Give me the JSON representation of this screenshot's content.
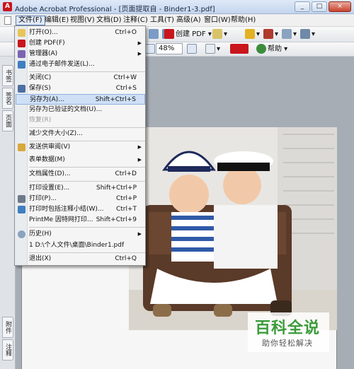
{
  "window": {
    "title": "Adobe Acrobat Professional - [页面提取自 - Binder1-3.pdf]",
    "min": "_",
    "restore": "□",
    "close": "×"
  },
  "menubar": [
    "文件(F)",
    "编辑(E)",
    "视图(V)",
    "文档(D)",
    "注释(C)",
    "工具(T)",
    "高级(A)",
    "窗口(W)",
    "帮助(H)"
  ],
  "toolbar": {
    "create_pdf": "创建 PDF",
    "zoom": "48%",
    "help": "帮助"
  },
  "left_tabs": [
    "书签",
    "签名",
    "页面",
    "附件",
    "注释"
  ],
  "file_menu": {
    "items": [
      {
        "label": "打开(O)...",
        "shortcut": "Ctrl+O"
      },
      {
        "label": "创建 PDF(F)",
        "shortcut": ""
      },
      {
        "label": "管理器(A)",
        "shortcut": ""
      },
      {
        "label": "通过电子邮件发送(L)...",
        "shortcut": ""
      },
      {
        "label": "关闭(C)",
        "shortcut": "Ctrl+W"
      },
      {
        "label": "保存(S)",
        "shortcut": "Ctrl+S"
      },
      {
        "label": "另存为(A)...",
        "shortcut": "Shift+Ctrl+S"
      },
      {
        "label": "另存为已验证的文档(U)...",
        "shortcut": ""
      },
      {
        "label": "恢复(R)",
        "shortcut": ""
      },
      {
        "label": "减少文件大小(Z)...",
        "shortcut": ""
      },
      {
        "label": "发送供审阅(V)",
        "shortcut": ""
      },
      {
        "label": "表单数据(M)",
        "shortcut": ""
      },
      {
        "label": "文档属性(D)...",
        "shortcut": "Ctrl+D"
      },
      {
        "label": "打印设置(E)...",
        "shortcut": "Shift+Ctrl+P"
      },
      {
        "label": "打印(P)...",
        "shortcut": "Ctrl+P"
      },
      {
        "label": "打印时包括注释小结(W)...",
        "shortcut": "Ctrl+T"
      },
      {
        "label": "PrintMe 因特网打印...",
        "shortcut": "Shift+Ctrl+9"
      },
      {
        "label": "历史(H)",
        "shortcut": ""
      },
      {
        "label": "1 D:\\个人文件\\桌面\\Binder1.pdf",
        "shortcut": ""
      },
      {
        "label": "退出(X)",
        "shortcut": "Ctrl+Q"
      }
    ]
  },
  "watermark": {
    "brand": "百科全说",
    "tagline": "助你轻松解决"
  }
}
